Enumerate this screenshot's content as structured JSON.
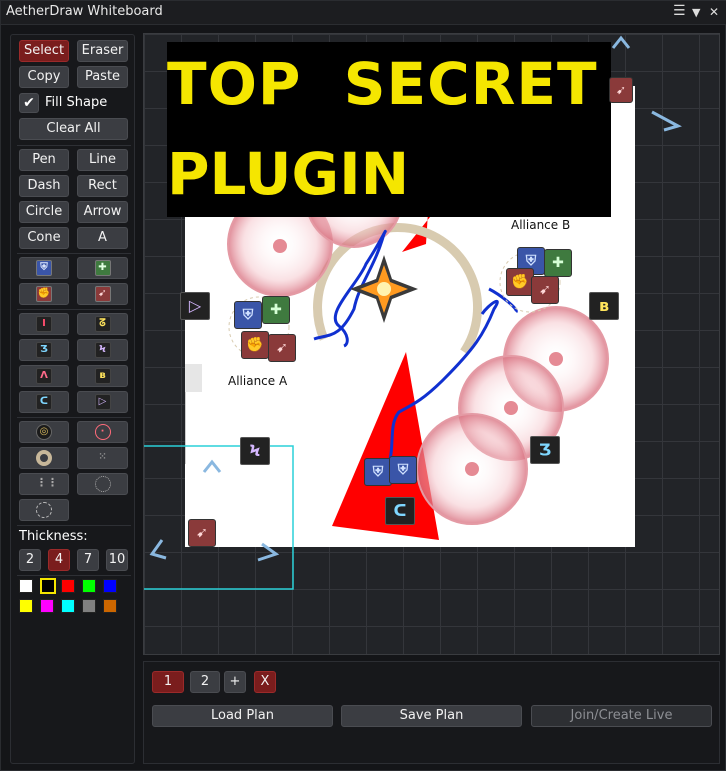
{
  "app": {
    "title": "AetherDraw Whiteboard",
    "menu_icon": "☰",
    "collapse_icon": "▼",
    "close_icon": "✕"
  },
  "toolbar": {
    "select": "Select",
    "eraser": "Eraser",
    "copy": "Copy",
    "paste": "Paste",
    "fill_shape": "Fill Shape",
    "fill_checked": true,
    "clear_all": "Clear All",
    "pen": "Pen",
    "line": "Line",
    "dash": "Dash",
    "rect": "Rect",
    "circle": "Circle",
    "arrow": "Arrow",
    "cone": "Cone",
    "text": "A",
    "thickness_label": "Thickness:",
    "thickness": [
      "2",
      "4",
      "7",
      "10"
    ],
    "thickness_selected": "4",
    "colors_row1": [
      "#ffffff",
      "#000000",
      "#ff0000",
      "#00ff00",
      "#0000ff"
    ],
    "colors_row2": [
      "#ffff00",
      "#ff00ff",
      "#00ffff",
      "#808080",
      "#cc6600"
    ],
    "selected_color": "#000000"
  },
  "canvas": {
    "banner_line1": "TOP  SECRET",
    "banner_line2": "PLUGIN",
    "alliance_a": "Alliance A",
    "alliance_b": "Alliance B"
  },
  "bottom": {
    "pages": [
      "1",
      "2"
    ],
    "active_page": "1",
    "add_page": "+",
    "delete_page": "X",
    "load_plan": "Load Plan",
    "save_plan": "Save Plan",
    "join_live": "Join/Create Live"
  }
}
